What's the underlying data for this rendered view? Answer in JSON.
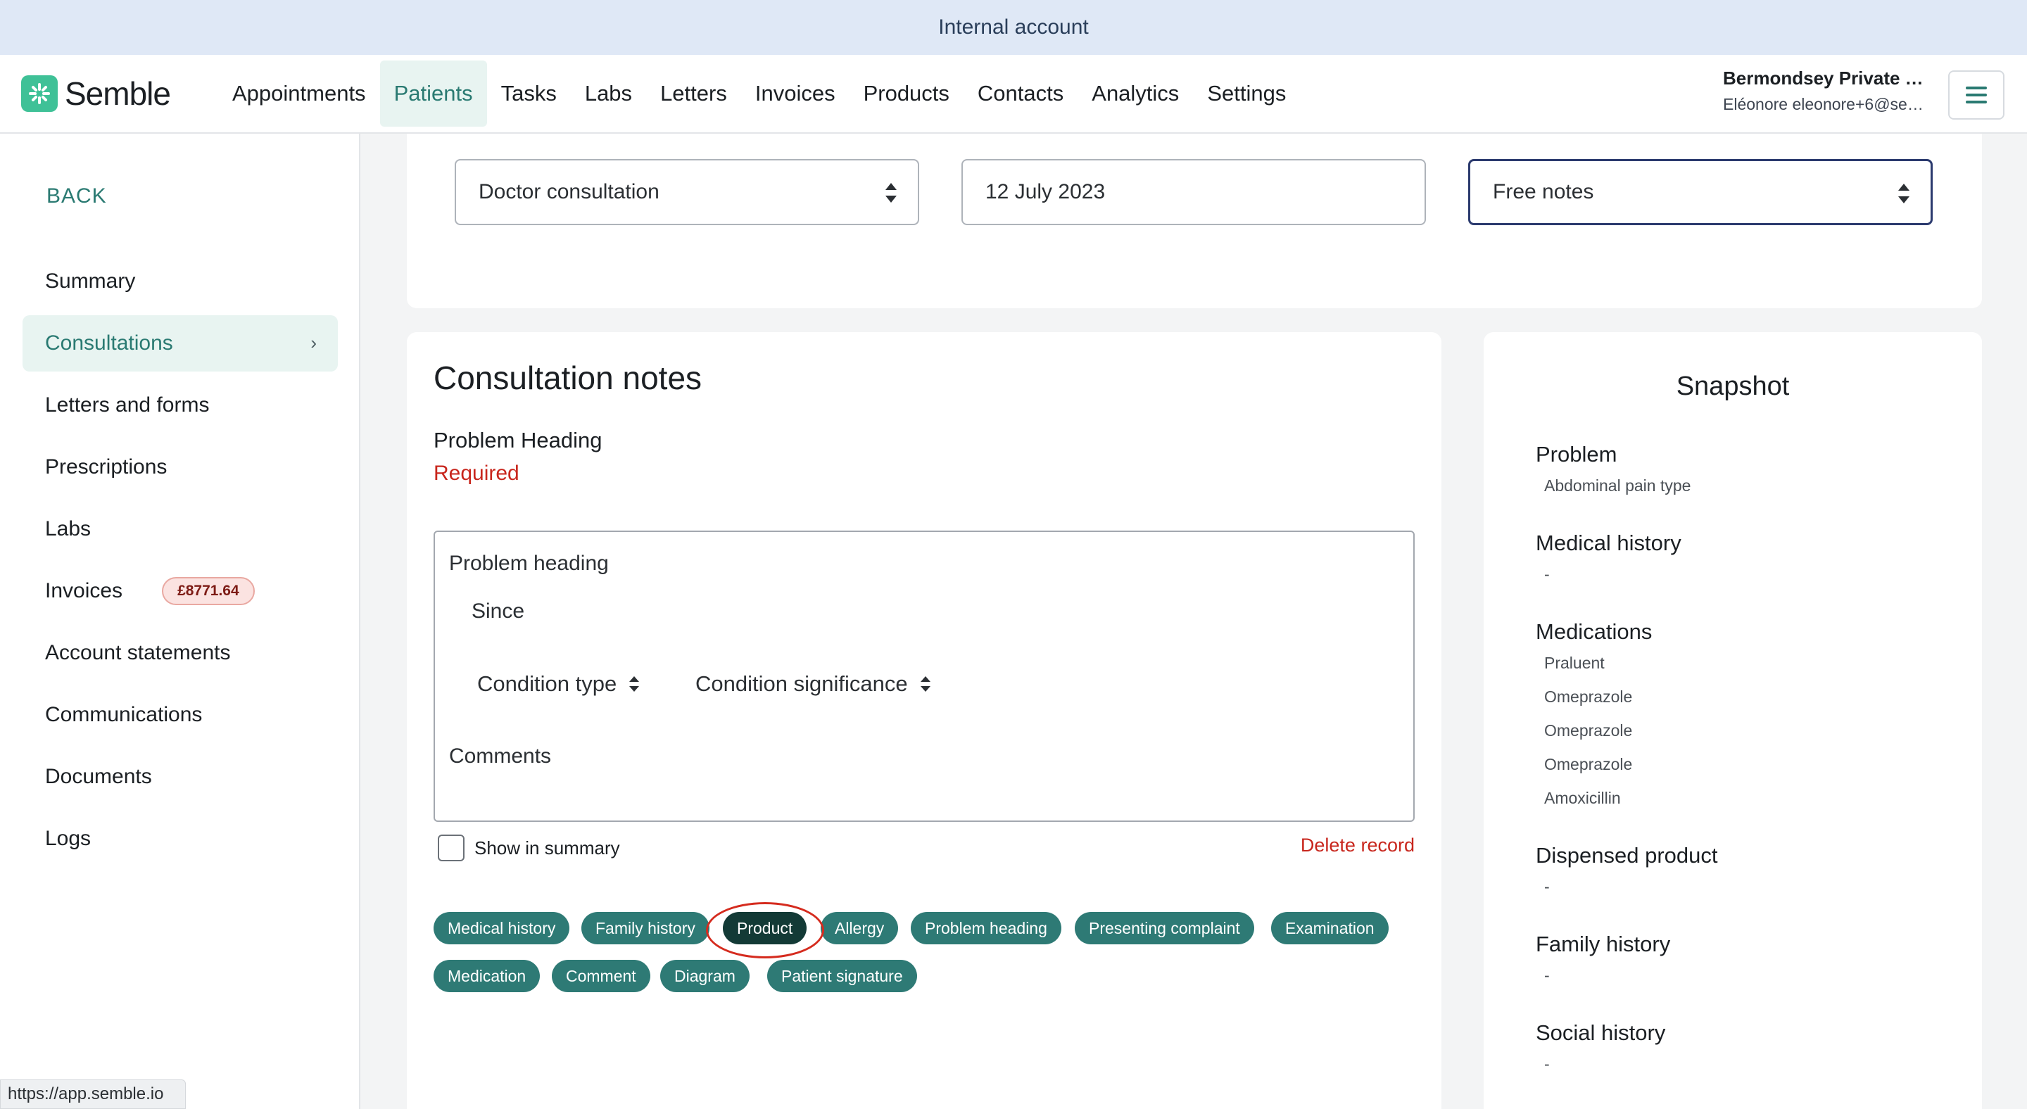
{
  "banner": {
    "text": "Internal account"
  },
  "brand": {
    "name": "Semble",
    "icon": "semble-logo-icon"
  },
  "nav": {
    "items": [
      "Appointments",
      "Patients",
      "Tasks",
      "Labs",
      "Letters",
      "Invoices",
      "Products",
      "Contacts",
      "Analytics",
      "Settings"
    ],
    "active": "Patients"
  },
  "account": {
    "name": "Bermondsey Private …",
    "email": "Eléonore eleonore+6@se…",
    "menu_icon": "hamburger-icon"
  },
  "sidebar": {
    "back": "BACK",
    "items": [
      {
        "label": "Summary"
      },
      {
        "label": "Consultations",
        "active": true
      },
      {
        "label": "Letters and forms"
      },
      {
        "label": "Prescriptions"
      },
      {
        "label": "Labs"
      },
      {
        "label": "Invoices",
        "badge": "£8771.64"
      },
      {
        "label": "Account statements"
      },
      {
        "label": "Communications"
      },
      {
        "label": "Documents"
      },
      {
        "label": "Logs"
      }
    ]
  },
  "url_tooltip": "https://app.semble.io",
  "consultation_header": {
    "type": "Doctor consultation",
    "date": "12 July 2023",
    "template": "Free notes"
  },
  "notes": {
    "title": "Consultation notes",
    "problem_heading_label": "Problem Heading",
    "required": "Required",
    "record": {
      "title": "Problem heading",
      "since": "Since",
      "condition_type": "Condition type",
      "condition_significance": "Condition significance",
      "comments": "Comments"
    },
    "show_in_summary": "Show in summary",
    "show_in_summary_checked": false,
    "delete": "Delete record",
    "tags": [
      "Medical history",
      "Family history",
      "Product",
      "Allergy",
      "Problem heading",
      "Presenting complaint",
      "Examination",
      "Medication",
      "Comment",
      "Diagram",
      "Patient signature"
    ],
    "highlighted_tag": "Product"
  },
  "snapshot": {
    "title": "Snapshot",
    "problem": {
      "label": "Problem",
      "value": "Abdominal pain type"
    },
    "medical_history": {
      "label": "Medical history",
      "value": "-"
    },
    "medications": {
      "label": "Medications",
      "values": [
        "Praluent",
        "Omeprazole",
        "Omeprazole",
        "Omeprazole",
        "Amoxicillin"
      ]
    },
    "dispensed_product": {
      "label": "Dispensed product",
      "value": "-"
    },
    "family_history": {
      "label": "Family history",
      "value": "-"
    },
    "social_history": {
      "label": "Social history",
      "value": "-"
    }
  },
  "colors": {
    "accent": "#2a7a72",
    "tag": "#2e7a75",
    "tag_selected": "#133a36",
    "error": "#c8261d",
    "banner": "#dfe8f6",
    "annotation_circle": "#d52b1e"
  }
}
